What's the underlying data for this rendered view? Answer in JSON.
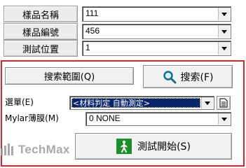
{
  "fields": {
    "sample_name_label": "樣品名稱",
    "sample_name_value": "111",
    "sample_id_label": "樣品編號",
    "sample_id_value": "456",
    "test_position_label": "測試位置",
    "test_position_value": "1"
  },
  "panel": {
    "search_range_button": "搜索範圍(Q)",
    "search_button": "搜索(F)",
    "menu_label": "選單(E)",
    "menu_value": "<材料判定 自動測定>",
    "mylar_label": "Mylar薄膜(M)",
    "mylar_value": "0 NONE",
    "start_test_button": "測試開始(S)"
  },
  "watermark": {
    "brand": "TechMax"
  },
  "colors": {
    "panel_border": "#d6262f",
    "selection": "#0a246a",
    "start_icon_bg": "#1a8f2a"
  },
  "icons": [
    "search-icon",
    "document-icon",
    "person-walking-icon"
  ]
}
